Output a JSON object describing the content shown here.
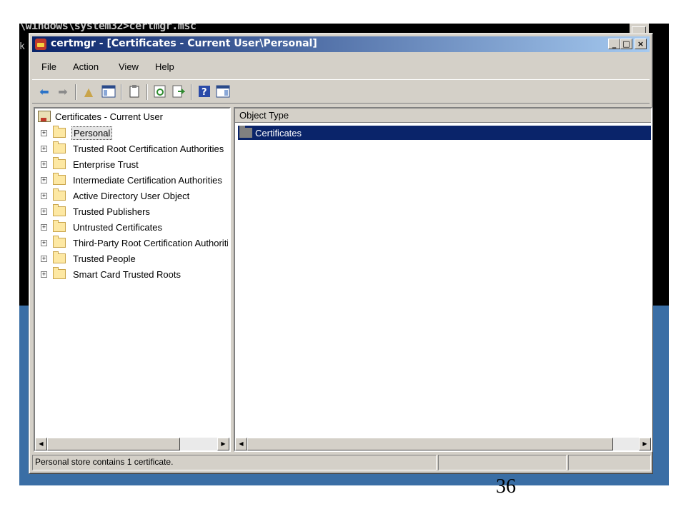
{
  "console": {
    "text": "\\windows\\system32>certmgr.msc",
    "side_text": "k"
  },
  "window": {
    "title": "certmgr - [Certificates - Current User\\Personal]",
    "buttons": {
      "minimize": "_",
      "maximize": "□",
      "close": "×"
    }
  },
  "menu": {
    "file": "File",
    "action": "Action",
    "view": "View",
    "help": "Help"
  },
  "tree": {
    "root": "Certificates - Current User",
    "items": [
      {
        "label": "Personal",
        "selected": true
      },
      {
        "label": "Trusted Root Certification Authorities"
      },
      {
        "label": "Enterprise Trust"
      },
      {
        "label": "Intermediate Certification Authorities"
      },
      {
        "label": "Active Directory User Object"
      },
      {
        "label": "Trusted Publishers"
      },
      {
        "label": "Untrusted Certificates"
      },
      {
        "label": "Third-Party Root Certification Authorities"
      },
      {
        "label": "Trusted People"
      },
      {
        "label": "Smart Card Trusted Roots"
      }
    ]
  },
  "list": {
    "column_header": "Object Type",
    "rows": [
      {
        "label": "Certificates"
      }
    ]
  },
  "status": {
    "message": "Personal store contains 1 certificate."
  },
  "slide": {
    "page_number": "36"
  },
  "colors": {
    "selection": "#0a246a",
    "desktop": "#3a6ea5",
    "chrome": "#d4d0c8"
  }
}
